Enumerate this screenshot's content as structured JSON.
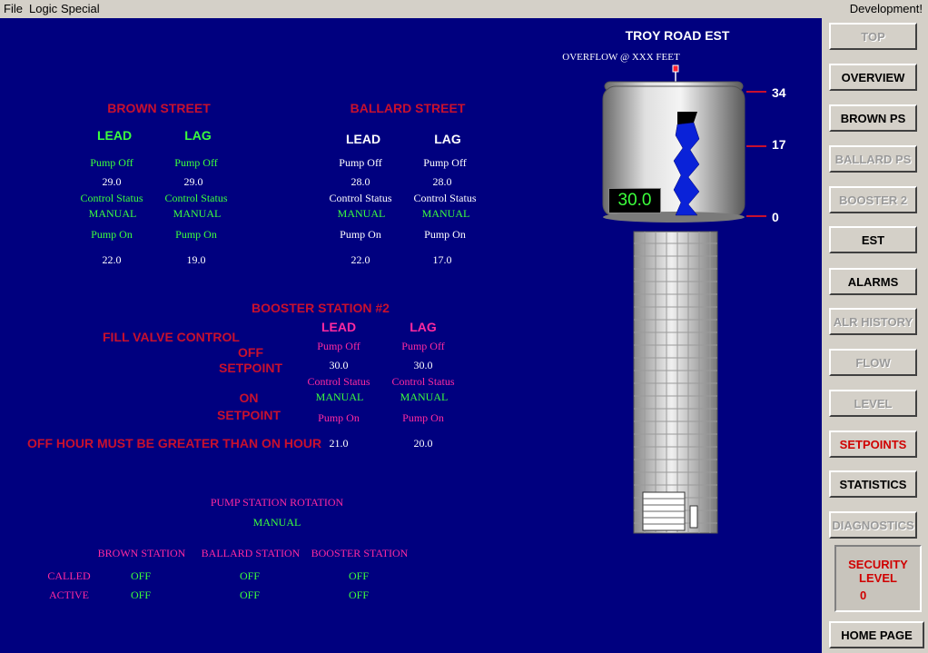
{
  "menu": {
    "file": "File",
    "logic": "Logic",
    "special": "Special",
    "right": "Development!"
  },
  "tank": {
    "title": "TROY ROAD EST",
    "overflow": "OVERFLOW @ XXX FEET",
    "scale": [
      "34",
      "17",
      "0"
    ],
    "level_value": "30.0",
    "level_max": 34,
    "level_current": 30.0
  },
  "brown": {
    "title": "BROWN STREET",
    "lead": {
      "label": "LEAD",
      "pump_off": "Pump Off",
      "off_val": "29.0",
      "ctrl": "Control Status",
      "mode": "MANUAL",
      "pump_on": "Pump On",
      "on_val": "22.0"
    },
    "lag": {
      "label": "LAG",
      "pump_off": "Pump Off",
      "off_val": "29.0",
      "ctrl": "Control Status",
      "mode": "MANUAL",
      "pump_on": "Pump On",
      "on_val": "19.0"
    }
  },
  "ballard": {
    "title": "BALLARD STREET",
    "lead": {
      "label": "LEAD",
      "pump_off": "Pump Off",
      "off_val": "28.0",
      "ctrl": "Control Status",
      "mode": "MANUAL",
      "pump_on": "Pump On",
      "on_val": "22.0"
    },
    "lag": {
      "label": "LAG",
      "pump_off": "Pump Off",
      "off_val": "28.0",
      "ctrl": "Control Status",
      "mode": "MANUAL",
      "pump_on": "Pump On",
      "on_val": "17.0"
    }
  },
  "booster": {
    "title": "BOOSTER STATION #2",
    "fill_valve": "FILL VALVE CONTROL",
    "off_label": "OFF",
    "setpoint1": "SETPOINT",
    "on_label": "ON",
    "setpoint2": "SETPOINT",
    "warning": "OFF HOUR MUST BE GREATER THAN ON HOUR",
    "lead": {
      "label": "LEAD",
      "pump_off": "Pump Off",
      "off_val": "30.0",
      "ctrl": "Control Status",
      "mode": "MANUAL",
      "pump_on": "Pump On",
      "on_val": "21.0"
    },
    "lag": {
      "label": "LAG",
      "pump_off": "Pump Off",
      "off_val": "30.0",
      "ctrl": "Control Status",
      "mode": "MANUAL",
      "pump_on": "Pump On",
      "on_val": "20.0"
    }
  },
  "rotation": {
    "title": "PUMP STATION ROTATION",
    "mode": "MANUAL",
    "headers": [
      "BROWN STATION",
      "BALLARD STATION",
      "BOOSTER STATION"
    ],
    "called": {
      "label": "CALLED",
      "values": [
        "OFF",
        "OFF",
        "OFF"
      ]
    },
    "active": {
      "label": "ACTIVE",
      "values": [
        "OFF",
        "OFF",
        "OFF"
      ]
    }
  },
  "nav": {
    "top": "TOP",
    "overview": "OVERVIEW",
    "brown_ps": "BROWN PS",
    "ballard_ps": "BALLARD PS",
    "booster2": "BOOSTER 2",
    "est": "EST",
    "alarms": "ALARMS",
    "alr_history": "ALR HISTORY",
    "flow": "FLOW",
    "level": "LEVEL",
    "setpoints": "SETPOINTS",
    "statistics": "STATISTICS",
    "diagnostics": "DIAGNOSTICS",
    "home": "HOME PAGE"
  },
  "security": {
    "line1": "SECURITY",
    "line2": "LEVEL",
    "value": "0"
  }
}
